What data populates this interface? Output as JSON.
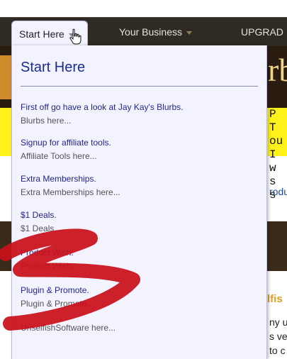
{
  "nav": {
    "items": [
      {
        "label": "Start Here"
      },
      {
        "label": "Your Business"
      },
      {
        "label": "UPGRAD"
      }
    ]
  },
  "dropdown": {
    "title": "Start Here",
    "items": [
      {
        "link": "First off go have a look at Jay Kay's Blurbs.",
        "sub": "Blurbs here..."
      },
      {
        "link": "Signup for affiliate tools.",
        "sub": "Affiliate Tools here..."
      },
      {
        "link": "Extra Memberships.",
        "sub": "Extra Memberships here..."
      },
      {
        "link": "$1 Deals.",
        "sub": "$1 Deals..."
      },
      {
        "link": "Product Wish.",
        "sub": "Product Wish..."
      },
      {
        "link": "Plugin & Promote.",
        "sub": "Plugin & Promote..."
      },
      {
        "link": "",
        "sub": "UnselfishSoftware here..."
      }
    ]
  },
  "background": {
    "banner_text": "rb",
    "yellow_text": [
      "P T",
      "ou",
      " I w",
      "s s"
    ],
    "link_fragment": "rodu",
    "gold_fragment": "lfis",
    "text_fragments": [
      "ny u",
      "s ve",
      "to c"
    ]
  },
  "colors": {
    "navbar": "#2f2a23",
    "dropdown_bg": "#f3f3ff",
    "link": "#22268a",
    "title": "#1a2c8c",
    "scribble": "#c8101a",
    "yellow_highlight": "#fff21b"
  }
}
